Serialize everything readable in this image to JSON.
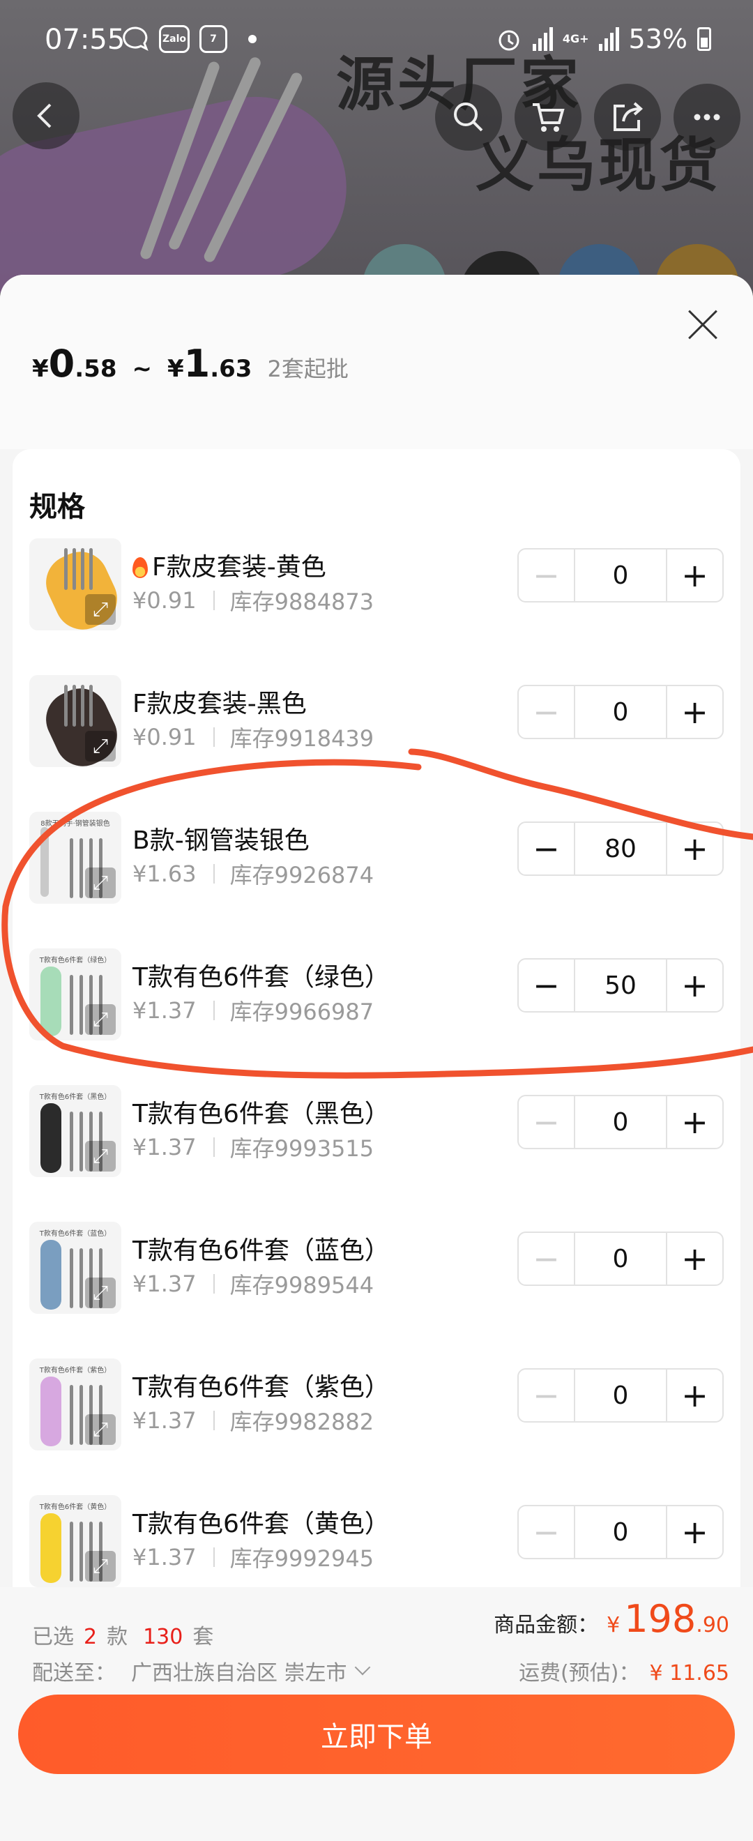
{
  "status_bar": {
    "time": "07:55",
    "app_icons": [
      "chat-icon",
      "Zalo",
      "7"
    ],
    "network": "4G+",
    "battery": "53%"
  },
  "background_banner": {
    "line1": "源头厂家",
    "line2": "义乌现货"
  },
  "price_header": {
    "currency": "¥",
    "min_int": "0",
    "min_dec": ".58",
    "tilde": "~",
    "max_int": "1",
    "max_dec": ".63",
    "moq": "2套起批"
  },
  "spec": {
    "title": "规格",
    "items": [
      {
        "name": "F款皮套装-黄色",
        "hot": true,
        "price": "¥0.91",
        "stock": "库存9884873",
        "qty": "0",
        "color": "#f2b33a"
      },
      {
        "name": "F款皮套装-黑色",
        "hot": false,
        "price": "¥0.91",
        "stock": "库存9918439",
        "qty": "0",
        "color": "#3a2f2c"
      },
      {
        "name": "B款-钢管装银色",
        "hot": false,
        "price": "¥1.63",
        "stock": "库存9926874",
        "qty": "80",
        "color": "#c9c9c9",
        "caption": "8款无刺手·钢管装银色"
      },
      {
        "name": "T款有色6件套（绿色）",
        "hot": false,
        "price": "¥1.37",
        "stock": "库存9966987",
        "qty": "50",
        "color": "#a7dcb8",
        "caption": "T款有色6件套（绿色）"
      },
      {
        "name": "T款有色6件套（黑色）",
        "hot": false,
        "price": "¥1.37",
        "stock": "库存9993515",
        "qty": "0",
        "color": "#2b2b2b",
        "caption": "T款有色6件套（黑色）"
      },
      {
        "name": "T款有色6件套（蓝色）",
        "hot": false,
        "price": "¥1.37",
        "stock": "库存9989544",
        "qty": "0",
        "color": "#7a9ec0",
        "caption": "T款有色6件套（蓝色）"
      },
      {
        "name": "T款有色6件套（紫色）",
        "hot": false,
        "price": "¥1.37",
        "stock": "库存9982882",
        "qty": "0",
        "color": "#d7a8e0",
        "caption": "T款有色6件套（紫色）"
      },
      {
        "name": "T款有色6件套（黄色）",
        "hot": false,
        "price": "¥1.37",
        "stock": "库存9992945",
        "qty": "0",
        "color": "#f6d230",
        "caption": "T款有色6件套（黄色）"
      }
    ]
  },
  "footer": {
    "selected_prefix": "已选",
    "selected_kinds": "2",
    "kinds_unit": "款",
    "selected_count": "130",
    "count_unit": "套",
    "ship_label": "配送至：",
    "ship_region": "广西壮族自治区 崇左市",
    "total_label": "商品金额：",
    "total_currency": "¥",
    "total_int": "198",
    "total_dec": ".90",
    "freight_label": "运费(预估)：",
    "freight_value": "¥ 11.65",
    "order_button": "立即下单"
  },
  "colors": {
    "accent": "#ff5b2a",
    "price_red": "#f04a1a",
    "annotation": "#f0522e"
  }
}
